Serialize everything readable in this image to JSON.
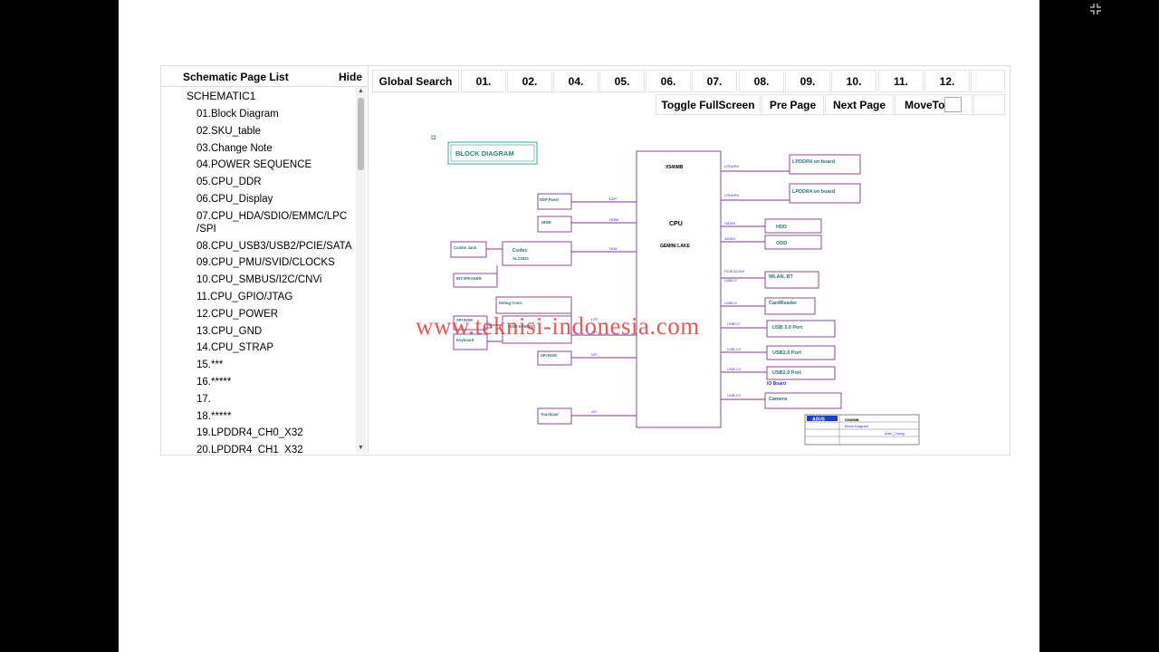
{
  "sidebar": {
    "title": "Schematic Page List",
    "hide_label": "Hide",
    "root": "SCHEMATIC1",
    "items": [
      "01.Block Diagram",
      "02.SKU_table",
      "03.Change Note",
      "04.POWER SEQUENCE",
      "05.CPU_DDR",
      "06.CPU_Display",
      "07.CPU_HDA/SDIO/EMMC/LPC /SPI",
      "08.CPU_USB3/USB2/PCIE/SATA",
      "09.CPU_PMU/SVID/CLOCKS",
      "10.CPU_SMBUS/I2C/CNVi",
      "11.CPU_GPIO/JTAG",
      "12.CPU_POWER",
      "13.CPU_GND",
      "14.CPU_STRAP",
      "15.***",
      "16.*****",
      "17.",
      "18.*****",
      "19.LPDDR4_CH0_X32",
      "20.LPDDR4_CH1_X32"
    ]
  },
  "toolbar": {
    "global_search": "Global Search",
    "pages": [
      "01.",
      "02.",
      "04.",
      "05.",
      "06.",
      "07.",
      "08.",
      "09.",
      "10.",
      "11.",
      "12."
    ],
    "toggle_fullscreen": "Toggle FullScreen",
    "pre_page": "Pre Page",
    "next_page": "Next Page",
    "move_to": "MoveTo"
  },
  "diagram": {
    "title": "BLOCK DIAGRAM",
    "cpu_model": "X540MB",
    "cpu_label": "CPU",
    "cpu_family": "GEMINI LAKE",
    "blocks": {
      "lpddr4_a": "LPDDR4 on board",
      "lpddr4_b": "LPDDR4 on board",
      "edp": "EDP Panel",
      "hdmi": "HDMI",
      "combo_jack": "Combo Jack",
      "codec": "Codec",
      "codec_part": "ALC3251",
      "int_speaker": "INT.SPEAKER",
      "hdd": "HDD",
      "odd": "ODD",
      "wlan": "WLAN, BT",
      "card_reader": "CardReader",
      "usb30": "USB 3.0 Port",
      "usb20a": "USB2.0 Port",
      "usb20b": "USB2.0 Port",
      "io_board": "IO Board",
      "camera": "Camera",
      "debug": "Debug Conn.",
      "spi_rom_a": "SPI ROM",
      "keyboard": "Keyboard",
      "ec": "ENE KB9022Q",
      "spi_rom_b": "SPI ROM",
      "touchpad": "Touchpad"
    },
    "bus_labels": {
      "lpddr4_a": "LPDDR4",
      "lpddr4_b": "LPDDR4",
      "edp": "EDP",
      "hdmi": "HDMI",
      "hda": "HDA",
      "sata0": "SATA0",
      "sata1": "SATA1",
      "pcie": "PCIE3/CNVi",
      "usb20_a": "USB2.0",
      "usb20_b": "USB2.0",
      "usb30": "USB3.0",
      "usb20_c": "USB 2.0",
      "usb20_d": "USB 2.0",
      "usb20_e": "USB 2.0",
      "lpc": "LPC",
      "spi_a": "SPI",
      "spi_b": "SPI",
      "i2c": "I2C"
    },
    "title_block": {
      "brand": "ASUS",
      "model": "X540MB",
      "sheet_title": "Block Diagram",
      "engineer": "Arlen_Chiang"
    }
  },
  "watermark": "www.teknisi-indonesia.com",
  "colors": {
    "block_border": "#7a3b8f",
    "block_text": "#2a6e7a",
    "bus_text": "#2b2bd6",
    "watermark": "#dc3c3c"
  }
}
